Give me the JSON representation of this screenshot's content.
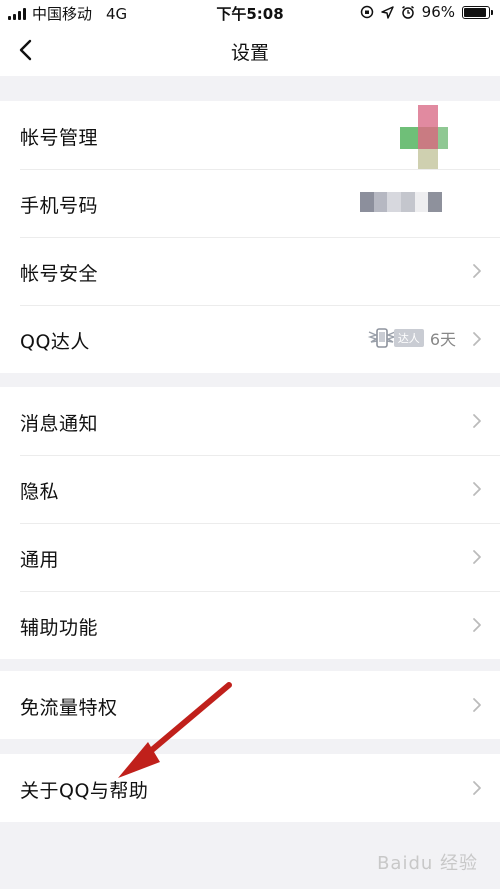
{
  "status_bar": {
    "carrier": "中国移动",
    "network": "4G",
    "time": "下午5:08",
    "battery": "96%",
    "battery_level": 0.96
  },
  "nav": {
    "title": "设置"
  },
  "groups": [
    {
      "items": [
        {
          "label": "帐号管理",
          "right": "avatar"
        },
        {
          "label": "手机号码",
          "right": "phone"
        },
        {
          "label": "帐号安全"
        },
        {
          "label": "QQ达人",
          "badge": "达人",
          "days": "6天"
        }
      ]
    },
    {
      "items": [
        {
          "label": "消息通知"
        },
        {
          "label": "隐私"
        },
        {
          "label": "通用"
        },
        {
          "label": "辅助功能"
        }
      ]
    },
    {
      "items": [
        {
          "label": "免流量特权"
        }
      ]
    },
    {
      "items": [
        {
          "label": "关于QQ与帮助"
        }
      ]
    }
  ],
  "watermark": "Baidu 经验",
  "colors": {
    "arrow": "#c0201b",
    "background": "#f2f2f5"
  }
}
